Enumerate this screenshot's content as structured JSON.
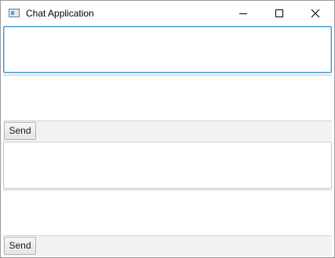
{
  "window": {
    "title": "Chat Application"
  },
  "panels": [
    {
      "send_label": "Send"
    },
    {
      "send_label": "Send"
    }
  ]
}
